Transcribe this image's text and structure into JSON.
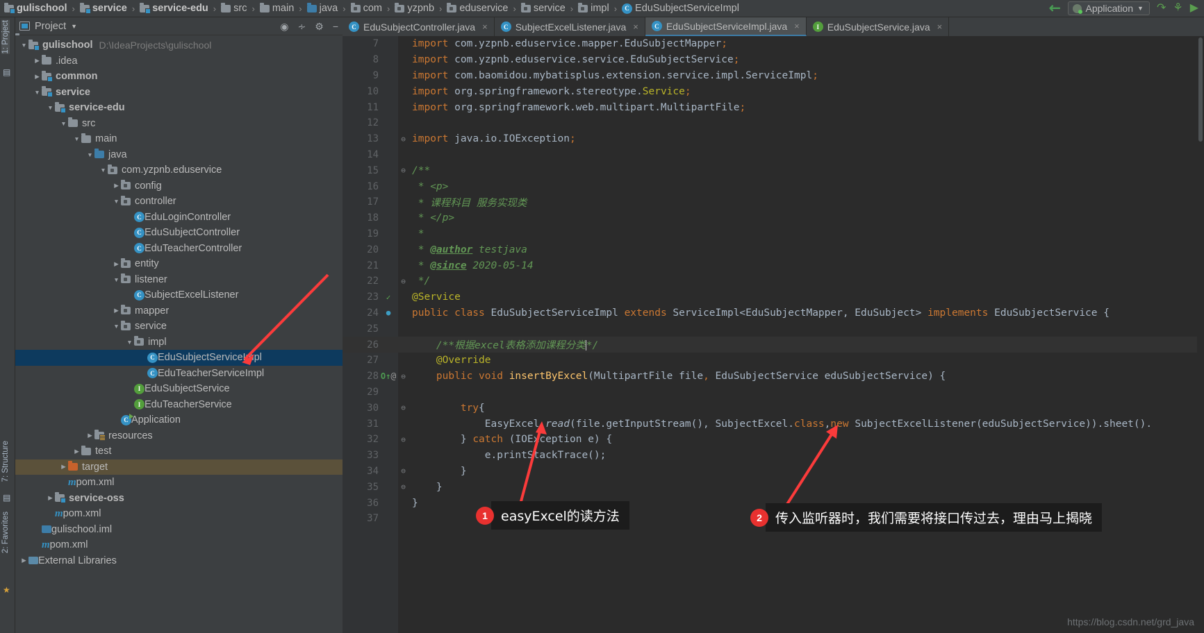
{
  "navbar": {
    "breadcrumbs": [
      {
        "label": "gulischool",
        "icon": "module-folder-icon",
        "bold": true
      },
      {
        "label": "service",
        "icon": "module-folder-icon",
        "bold": true
      },
      {
        "label": "service-edu",
        "icon": "module-folder-icon",
        "bold": true
      },
      {
        "label": "src",
        "icon": "folder-icon",
        "bold": false
      },
      {
        "label": "main",
        "icon": "folder-icon",
        "bold": false
      },
      {
        "label": "java",
        "icon": "source-folder-icon",
        "bold": false
      },
      {
        "label": "com",
        "icon": "package-icon",
        "bold": false
      },
      {
        "label": "yzpnb",
        "icon": "package-icon",
        "bold": false
      },
      {
        "label": "eduservice",
        "icon": "package-icon",
        "bold": false
      },
      {
        "label": "service",
        "icon": "package-icon",
        "bold": false
      },
      {
        "label": "impl",
        "icon": "package-icon",
        "bold": false
      },
      {
        "label": "EduSubjectServiceImpl",
        "icon": "class-icon",
        "bold": false
      }
    ],
    "separator": "›",
    "back_arrow_icon": "navigate-back-arrow-icon",
    "run_config": {
      "label": "Application",
      "caret": "▼",
      "icon": "run-configuration-icon"
    },
    "run_button_icon": "run-icon",
    "debug_button_icon": "debug-icon",
    "run_coverage_icon": "run-with-coverage-icon"
  },
  "left_strips": [
    {
      "label": "1: Project",
      "active": true
    },
    {
      "label": "7: Structure",
      "active": false
    },
    {
      "label": "2: Favorites",
      "active": false
    }
  ],
  "project_panel": {
    "title": "Project",
    "caret": "▼",
    "icons": [
      "locate-icon",
      "collapse-all-icon",
      "settings-gear-icon",
      "minimize-icon"
    ],
    "tree": [
      {
        "indent": 0,
        "arrow": "▼",
        "icon": "module-folder-icon",
        "name": "gulischool",
        "bold": true,
        "path": "D:\\IdeaProjects\\gulischool",
        "state": "normal"
      },
      {
        "indent": 1,
        "arrow": "▶",
        "icon": "folder-icon",
        "name": ".idea",
        "bold": false,
        "path": "",
        "state": "normal"
      },
      {
        "indent": 1,
        "arrow": "▶",
        "icon": "module-folder-icon",
        "name": "common",
        "bold": true,
        "path": "",
        "state": "normal"
      },
      {
        "indent": 1,
        "arrow": "▼",
        "icon": "module-folder-icon",
        "name": "service",
        "bold": true,
        "path": "",
        "state": "normal"
      },
      {
        "indent": 2,
        "arrow": "▼",
        "icon": "module-folder-icon",
        "name": "service-edu",
        "bold": true,
        "path": "",
        "state": "normal"
      },
      {
        "indent": 3,
        "arrow": "▼",
        "icon": "folder-icon",
        "name": "src",
        "bold": false,
        "path": "",
        "state": "normal"
      },
      {
        "indent": 4,
        "arrow": "▼",
        "icon": "folder-icon",
        "name": "main",
        "bold": false,
        "path": "",
        "state": "normal"
      },
      {
        "indent": 5,
        "arrow": "▼",
        "icon": "source-folder-icon",
        "name": "java",
        "bold": false,
        "path": "",
        "state": "normal"
      },
      {
        "indent": 6,
        "arrow": "▼",
        "icon": "package-icon",
        "name": "com.yzpnb.eduservice",
        "bold": false,
        "path": "",
        "state": "normal"
      },
      {
        "indent": 7,
        "arrow": "▶",
        "icon": "package-icon",
        "name": "config",
        "bold": false,
        "path": "",
        "state": "normal"
      },
      {
        "indent": 7,
        "arrow": "▼",
        "icon": "package-icon",
        "name": "controller",
        "bold": false,
        "path": "",
        "state": "normal"
      },
      {
        "indent": 8,
        "arrow": "",
        "icon": "class-icon",
        "name": "EduLoginController",
        "bold": false,
        "path": "",
        "state": "normal"
      },
      {
        "indent": 8,
        "arrow": "",
        "icon": "class-icon",
        "name": "EduSubjectController",
        "bold": false,
        "path": "",
        "state": "normal"
      },
      {
        "indent": 8,
        "arrow": "",
        "icon": "class-icon",
        "name": "EduTeacherController",
        "bold": false,
        "path": "",
        "state": "normal"
      },
      {
        "indent": 7,
        "arrow": "▶",
        "icon": "package-icon",
        "name": "entity",
        "bold": false,
        "path": "",
        "state": "normal"
      },
      {
        "indent": 7,
        "arrow": "▼",
        "icon": "package-icon",
        "name": "listener",
        "bold": false,
        "path": "",
        "state": "normal"
      },
      {
        "indent": 8,
        "arrow": "",
        "icon": "class-icon",
        "name": "SubjectExcelListener",
        "bold": false,
        "path": "",
        "state": "normal"
      },
      {
        "indent": 7,
        "arrow": "▶",
        "icon": "package-icon",
        "name": "mapper",
        "bold": false,
        "path": "",
        "state": "normal"
      },
      {
        "indent": 7,
        "arrow": "▼",
        "icon": "package-icon",
        "name": "service",
        "bold": false,
        "path": "",
        "state": "normal"
      },
      {
        "indent": 8,
        "arrow": "▼",
        "icon": "package-icon",
        "name": "impl",
        "bold": false,
        "path": "",
        "state": "normal"
      },
      {
        "indent": 9,
        "arrow": "",
        "icon": "class-icon",
        "name": "EduSubjectServiceImpl",
        "bold": false,
        "path": "",
        "state": "selected"
      },
      {
        "indent": 9,
        "arrow": "",
        "icon": "class-icon",
        "name": "EduTeacherServiceImpl",
        "bold": false,
        "path": "",
        "state": "normal"
      },
      {
        "indent": 8,
        "arrow": "",
        "icon": "interface-icon",
        "name": "EduSubjectService",
        "bold": false,
        "path": "",
        "state": "normal"
      },
      {
        "indent": 8,
        "arrow": "",
        "icon": "interface-icon",
        "name": "EduTeacherService",
        "bold": false,
        "path": "",
        "state": "normal"
      },
      {
        "indent": 7,
        "arrow": "",
        "icon": "spring-app-icon",
        "name": "Application",
        "bold": false,
        "path": "",
        "state": "normal"
      },
      {
        "indent": 5,
        "arrow": "▶",
        "icon": "resources-folder-icon",
        "name": "resources",
        "bold": false,
        "path": "",
        "state": "normal"
      },
      {
        "indent": 4,
        "arrow": "▶",
        "icon": "folder-icon",
        "name": "test",
        "bold": false,
        "path": "",
        "state": "normal"
      },
      {
        "indent": 3,
        "arrow": "▶",
        "icon": "target-folder-icon",
        "name": "target",
        "bold": false,
        "path": "",
        "state": "highlighted"
      },
      {
        "indent": 3,
        "arrow": "",
        "icon": "maven-icon",
        "name": "pom.xml",
        "bold": false,
        "path": "",
        "state": "normal"
      },
      {
        "indent": 2,
        "arrow": "▶",
        "icon": "module-folder-icon",
        "name": "service-oss",
        "bold": true,
        "path": "",
        "state": "normal"
      },
      {
        "indent": 2,
        "arrow": "",
        "icon": "maven-icon",
        "name": "pom.xml",
        "bold": false,
        "path": "",
        "state": "normal"
      },
      {
        "indent": 1,
        "arrow": "",
        "icon": "iml-file-icon",
        "name": "gulischool.iml",
        "bold": false,
        "path": "",
        "state": "normal"
      },
      {
        "indent": 1,
        "arrow": "",
        "icon": "maven-icon",
        "name": "pom.xml",
        "bold": false,
        "path": "",
        "state": "normal"
      },
      {
        "indent": 0,
        "arrow": "▶",
        "icon": "external-libraries-icon",
        "name": "External Libraries",
        "bold": false,
        "path": "",
        "state": "normal"
      }
    ]
  },
  "editor": {
    "tabs": [
      {
        "label": "EduSubjectController.java",
        "icon": "class-icon",
        "icon_color": "#3592c4",
        "active": false,
        "close": "×"
      },
      {
        "label": "SubjectExcelListener.java",
        "icon": "class-icon",
        "icon_color": "#3592c4",
        "active": false,
        "close": "×"
      },
      {
        "label": "EduSubjectServiceImpl.java",
        "icon": "class-icon",
        "icon_color": "#3592c4",
        "active": true,
        "close": "×"
      },
      {
        "label": "EduSubjectService.java",
        "icon": "interface-icon",
        "icon_color": "#539e3c",
        "active": false,
        "close": "×"
      }
    ],
    "lines": [
      {
        "num": "7",
        "gutter": "",
        "fold": "",
        "current": false,
        "html": "<span class=\"k\">import</span> <span class=\"n\">com.yzpnb.eduservice.mapper.EduSubjectMapper</span><span class=\"k\">;</span>"
      },
      {
        "num": "8",
        "gutter": "",
        "fold": "",
        "current": false,
        "html": "<span class=\"k\">import</span> <span class=\"n\">com.yzpnb.eduservice.service.EduSubjectService</span><span class=\"k\">;</span>"
      },
      {
        "num": "9",
        "gutter": "",
        "fold": "",
        "current": false,
        "html": "<span class=\"k\">import</span> <span class=\"n\">com.baomidou.mybatisplus.extension.service.impl.ServiceImpl</span><span class=\"k\">;</span>"
      },
      {
        "num": "10",
        "gutter": "",
        "fold": "",
        "current": false,
        "html": "<span class=\"k\">import</span> <span class=\"n\">org.springframework.stereotype.</span><span class=\"an\">Service</span><span class=\"k\">;</span>"
      },
      {
        "num": "11",
        "gutter": "",
        "fold": "",
        "current": false,
        "html": "<span class=\"k\">import</span> <span class=\"n\">org.springframework.web.multipart.MultipartFile</span><span class=\"k\">;</span>"
      },
      {
        "num": "12",
        "gutter": "",
        "fold": "",
        "current": false,
        "html": ""
      },
      {
        "num": "13",
        "gutter": "",
        "fold": "⊖",
        "current": false,
        "html": "<span class=\"k\">import</span> <span class=\"n\">java.io.IOException</span><span class=\"k\">;</span>"
      },
      {
        "num": "14",
        "gutter": "",
        "fold": "",
        "current": false,
        "html": ""
      },
      {
        "num": "15",
        "gutter": "",
        "fold": "⊖",
        "current": false,
        "html": "<span class=\"jd\">/**</span>"
      },
      {
        "num": "16",
        "gutter": "",
        "fold": "",
        "current": false,
        "html": "<span class=\"jd\"> * &lt;p&gt;</span>"
      },
      {
        "num": "17",
        "gutter": "",
        "fold": "",
        "current": false,
        "html": "<span class=\"jd\"> * 课程科目 服务实现类</span>"
      },
      {
        "num": "18",
        "gutter": "",
        "fold": "",
        "current": false,
        "html": "<span class=\"jd\"> * &lt;/p&gt;</span>"
      },
      {
        "num": "19",
        "gutter": "",
        "fold": "",
        "current": false,
        "html": "<span class=\"jd\"> *</span>"
      },
      {
        "num": "20",
        "gutter": "",
        "fold": "",
        "current": false,
        "html": "<span class=\"jd\"> * </span><span class=\"jdt\">@author</span><span class=\"jd\"> testjava</span>"
      },
      {
        "num": "21",
        "gutter": "",
        "fold": "",
        "current": false,
        "html": "<span class=\"jd\"> * </span><span class=\"jdt\">@since</span><span class=\"jd\"> 2020-05-14</span>"
      },
      {
        "num": "22",
        "gutter": "",
        "fold": "⊖",
        "current": false,
        "html": "<span class=\"jd\"> */</span>"
      },
      {
        "num": "23",
        "gutter": "bean-green",
        "fold": "",
        "current": false,
        "html": "<span class=\"an\">@Service</span>"
      },
      {
        "num": "24",
        "gutter": "bean-blue",
        "fold": "",
        "current": false,
        "html": "<span class=\"k\">public class</span> <span class=\"n\">EduSubjectServiceImpl</span> <span class=\"k\">extends</span> <span class=\"n\">ServiceImpl&lt;EduSubjectMapper, EduSubject&gt;</span> <span class=\"k\">implements</span> <span class=\"n\">EduSubjectService</span> <span class=\"n\">{</span>"
      },
      {
        "num": "25",
        "gutter": "",
        "fold": "",
        "current": false,
        "html": ""
      },
      {
        "num": "26",
        "gutter": "",
        "fold": "",
        "current": true,
        "html": "    <span class=\"jd\">/**根据excel表格添加课程分类</span><span class=\"caret-bar\"></span><span class=\"jd\">*/</span>"
      },
      {
        "num": "27",
        "gutter": "",
        "fold": "",
        "current": false,
        "html": "    <span class=\"an\">@Override</span>"
      },
      {
        "num": "28",
        "gutter": "override-marker",
        "fold": "⊖",
        "current": false,
        "html": "    <span class=\"k\">public void</span> <span class=\"m\">insertByExcel</span><span class=\"n\">(MultipartFile file</span><span class=\"k\">,</span><span class=\"n\"> EduSubjectService eduSubjectService) {</span>"
      },
      {
        "num": "29",
        "gutter": "",
        "fold": "",
        "current": false,
        "html": ""
      },
      {
        "num": "30",
        "gutter": "",
        "fold": "⊖",
        "current": false,
        "html": "        <span class=\"k\">try</span><span class=\"n\">{</span>"
      },
      {
        "num": "31",
        "gutter": "",
        "fold": "",
        "current": false,
        "html": "            <span class=\"n\">EasyExcel.</span><span class=\"it\">read</span><span class=\"n\">(file.getInputStream(), SubjectExcel.</span><span class=\"k\">class</span><span class=\"n\">,</span><span class=\"k\">new</span> <span class=\"n\">SubjectExcelListener(eduSubjectService)).sheet().</span>"
      },
      {
        "num": "32",
        "gutter": "",
        "fold": "⊖",
        "current": false,
        "html": "        <span class=\"n\">}</span> <span class=\"k\">catch</span> <span class=\"n\">(IOException e) {</span>"
      },
      {
        "num": "33",
        "gutter": "",
        "fold": "",
        "current": false,
        "html": "            <span class=\"n\">e.printStackTrace();</span>"
      },
      {
        "num": "34",
        "gutter": "",
        "fold": "⊖",
        "current": false,
        "html": "        <span class=\"n\">}</span>"
      },
      {
        "num": "35",
        "gutter": "",
        "fold": "⊖",
        "current": false,
        "html": "    <span class=\"n\">}</span>"
      },
      {
        "num": "36",
        "gutter": "",
        "fold": "",
        "current": false,
        "html": "<span class=\"n\">}</span>"
      },
      {
        "num": "37",
        "gutter": "",
        "fold": "",
        "current": false,
        "html": ""
      }
    ]
  },
  "annotations": [
    {
      "badge": "1",
      "text": "easyExcel的读方法"
    },
    {
      "badge": "2",
      "text": "传入监听器时，我们需要将接口传过去，理由马上揭晓"
    }
  ],
  "watermark": "https://blog.csdn.net/grd_java"
}
